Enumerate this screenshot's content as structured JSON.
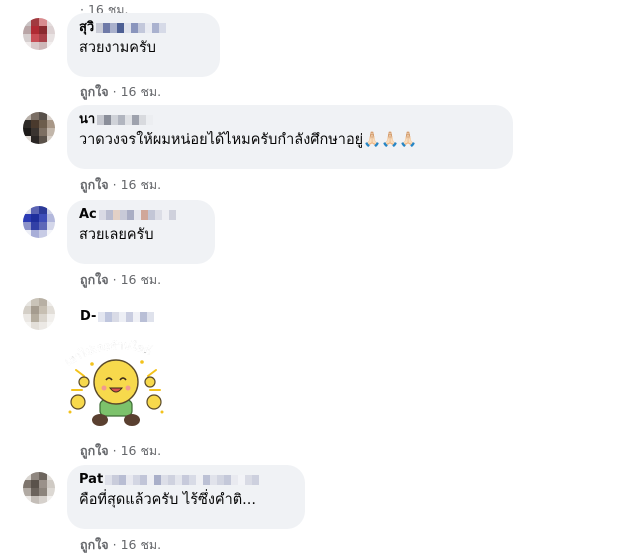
{
  "top_meta": "· 16 ชม.",
  "comments": [
    {
      "name": "สุวิ",
      "text": "สวยงามครับ",
      "like_label": "ถูกใจ",
      "time": "16 ชม.",
      "avatar_colors": [
        "#c9c2c3",
        "#a13a3f",
        "#d88c8f",
        "#e4dcdc",
        "#b9a5a6",
        "#b02a33",
        "#8a2a2f",
        "#ddd2d3",
        "#d6cfcf",
        "#c84d55",
        "#a84048",
        "#e8e2e2",
        "#efeaea",
        "#d9c8c9",
        "#cdb7b8",
        "#f2eeee"
      ]
    },
    {
      "name": "นา",
      "text": "วาดวงจรให้ผมหน่อยได้ไหมครับกำลังศึกษาอยู่🙏🏻🙏🏻🙏🏻",
      "like_label": "ถูกใจ",
      "time": "16 ชม.",
      "avatar_colors": [
        "#b6aea7",
        "#7a6e64",
        "#58504a",
        "#d8d0c9",
        "#2e2a27",
        "#4a3a2d",
        "#6d5d4c",
        "#a89787",
        "#1c1a18",
        "#3a3430",
        "#7d6f62",
        "#c2b6aa",
        "#e0dad4",
        "#2a2624",
        "#5b524a",
        "#d6cec6"
      ]
    },
    {
      "name": "Ac",
      "text": "สวยเลยครับ",
      "like_label": "ถูกใจ",
      "time": "16 ชม.",
      "avatar_colors": [
        "#d9dbe8",
        "#5b63b3",
        "#2c3a98",
        "#cfd2e6",
        "#2b3bb4",
        "#1f2e9c",
        "#3e4db8",
        "#b3b8dc",
        "#8d93c9",
        "#3240a6",
        "#5e68b8",
        "#d4d7ea",
        "#eceef6",
        "#a8aed8",
        "#c7cbe5",
        "#f4f5fa"
      ]
    },
    {
      "name": "D-",
      "text": "",
      "sticker_text": "เอาไปเลยล้านไลค์",
      "like_label": "ถูกใจ",
      "time": "16 ชม.",
      "avatar_colors": [
        "#e6e4e0",
        "#c9c3b8",
        "#b8b0a4",
        "#efedea",
        "#d4cfc7",
        "#a59c8f",
        "#c7bfb2",
        "#e2ded8",
        "#ebe8e4",
        "#b5ad9f",
        "#dad5cd",
        "#f1efec",
        "#f5f4f2",
        "#e3dfd9",
        "#ece9e5",
        "#f7f6f4"
      ]
    },
    {
      "name": "Pat",
      "text": "คือที่สุดแล้วครับ ไร้ซึ่งคำติ...",
      "like_label": "ถูกใจ",
      "time": "16 ชม.",
      "avatar_colors": [
        "#d8d4cf",
        "#8f8780",
        "#6d655e",
        "#e2ded9",
        "#7e756d",
        "#5a524b",
        "#9a918a",
        "#cfcac4",
        "#b1aaa3",
        "#6b635c",
        "#8c847c",
        "#dcd8d3",
        "#ece9e6",
        "#c4beb8",
        "#d6d1cc",
        "#f2f0ee"
      ]
    }
  ],
  "blur_colors": {
    "c0": [
      "#c9cbd6",
      "#6f7aa8",
      "#a9b0cc",
      "#4d5f94",
      "#dfe2ec",
      "#8a95bd",
      "#c3c8db",
      "#e9ebf2",
      "#aab2cf",
      "#d6dae7"
    ],
    "c1": [
      "#c6c8cf",
      "#8a8e99",
      "#cfd2d8",
      "#b1b5bf",
      "#dfe1e5",
      "#9ea2ad",
      "#d8dade",
      "#eceef1"
    ],
    "c2": [
      "#d9dae4",
      "#b9bccf",
      "#e3d1c6",
      "#c8cad8",
      "#a9adc4",
      "#e6e7ee",
      "#d0a79a",
      "#c3c6d6",
      "#dcdde6",
      "#eeeef3",
      "#cfd1dc"
    ],
    "c3": [
      "#e3e6f0",
      "#bfc6de",
      "#d9dbe6",
      "#edeff5",
      "#c9cde0",
      "#f0f1f6",
      "#b9bfd6",
      "#dfe2ec"
    ],
    "c4": [
      "#dfe1ea",
      "#c9ccdb",
      "#b8bdd3",
      "#e8e9f0",
      "#d3d6e3",
      "#c1c5d8",
      "#eeeff4",
      "#a9afc9",
      "#dcdee8",
      "#cfd2df",
      "#e4e6ed",
      "#c7cadb",
      "#d8dbe6",
      "#eff0f4",
      "#bcc1d5",
      "#e1e3eb",
      "#d2d5e1",
      "#c4c8d9",
      "#e9eaf0",
      "#f2f3f7",
      "#d9dbe5",
      "#cdd0de"
    ]
  }
}
